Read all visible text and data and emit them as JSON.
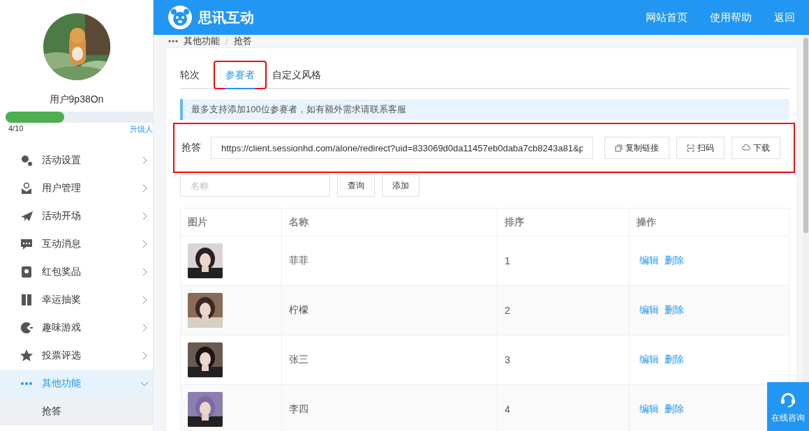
{
  "sidebar": {
    "user": {
      "name": "用户9p38On",
      "level": 0.4,
      "quota": "4/10",
      "upgrade": "升级人"
    },
    "items": [
      {
        "label": "活动设置",
        "expanded": false,
        "selected": false
      },
      {
        "label": "用户管理",
        "expanded": false,
        "selected": false
      },
      {
        "label": "活动开场",
        "expanded": false,
        "selected": false
      },
      {
        "label": "互动消息",
        "expanded": false,
        "selected": false
      },
      {
        "label": "红包奖品",
        "expanded": false,
        "selected": false
      },
      {
        "label": "幸运抽奖",
        "expanded": false,
        "selected": false
      },
      {
        "label": "趣味游戏",
        "expanded": false,
        "selected": false
      },
      {
        "label": "投票评选",
        "expanded": false,
        "selected": false
      },
      {
        "label": "其他功能",
        "expanded": true,
        "selected": true,
        "children": [
          {
            "label": "抢答",
            "selected": true
          }
        ]
      }
    ]
  },
  "header": {
    "title": "思讯互动",
    "links": [
      "网站首页",
      "使用帮助",
      "返回"
    ]
  },
  "breadcrumb": {
    "items": [
      "其他功能",
      "抢答"
    ],
    "separator": "/"
  },
  "tabs": [
    {
      "label": "轮次",
      "selected": false,
      "highlighted": false
    },
    {
      "label": "参赛者",
      "selected": true,
      "highlighted": true
    },
    {
      "label": "自定义风格",
      "selected": false,
      "highlighted": false
    }
  ],
  "notice": "最多支持添加100位参赛者，如有额外需求请联系客服",
  "link_row": {
    "label": "抢答",
    "url": "https://client.sessionhd.com/alone/redirect?uid=833069d0da11457eb0daba7cb8243a81&p",
    "highlighted": true,
    "buttons": [
      "复制链接",
      "扫码",
      "下载"
    ]
  },
  "search": {
    "placeholder": "名称",
    "buttons": [
      "查询",
      "添加"
    ]
  },
  "table": {
    "columns": [
      "图片",
      "名称",
      "排序",
      "操作"
    ],
    "rows": [
      {
        "picture": {
          "kind": "picture"
        },
        "name": "菲菲",
        "order": "1",
        "actions": [
          "编辑",
          "删除"
        ]
      },
      {
        "picture": {
          "kind": "picture"
        },
        "name": "柠檬",
        "order": "2",
        "actions": [
          "编辑",
          "删除"
        ]
      },
      {
        "picture": {
          "kind": "picture"
        },
        "name": "张三",
        "order": "3",
        "actions": [
          "编辑",
          "删除"
        ]
      },
      {
        "picture": {
          "kind": "picture"
        },
        "name": "李四",
        "order": "4",
        "actions": [
          "编辑",
          "删除"
        ]
      }
    ]
  },
  "float_button": {
    "label": "在线咨询"
  }
}
